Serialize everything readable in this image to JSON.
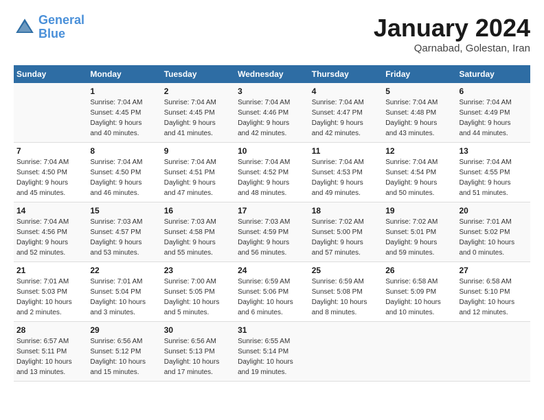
{
  "logo": {
    "line1": "General",
    "line2": "Blue"
  },
  "title": "January 2024",
  "subtitle": "Qarnabad, Golestan, Iran",
  "days_of_week": [
    "Sunday",
    "Monday",
    "Tuesday",
    "Wednesday",
    "Thursday",
    "Friday",
    "Saturday"
  ],
  "weeks": [
    [
      {
        "day": "",
        "info": ""
      },
      {
        "day": "1",
        "info": "Sunrise: 7:04 AM\nSunset: 4:45 PM\nDaylight: 9 hours\nand 40 minutes."
      },
      {
        "day": "2",
        "info": "Sunrise: 7:04 AM\nSunset: 4:45 PM\nDaylight: 9 hours\nand 41 minutes."
      },
      {
        "day": "3",
        "info": "Sunrise: 7:04 AM\nSunset: 4:46 PM\nDaylight: 9 hours\nand 42 minutes."
      },
      {
        "day": "4",
        "info": "Sunrise: 7:04 AM\nSunset: 4:47 PM\nDaylight: 9 hours\nand 42 minutes."
      },
      {
        "day": "5",
        "info": "Sunrise: 7:04 AM\nSunset: 4:48 PM\nDaylight: 9 hours\nand 43 minutes."
      },
      {
        "day": "6",
        "info": "Sunrise: 7:04 AM\nSunset: 4:49 PM\nDaylight: 9 hours\nand 44 minutes."
      }
    ],
    [
      {
        "day": "7",
        "info": "Sunrise: 7:04 AM\nSunset: 4:50 PM\nDaylight: 9 hours\nand 45 minutes."
      },
      {
        "day": "8",
        "info": "Sunrise: 7:04 AM\nSunset: 4:50 PM\nDaylight: 9 hours\nand 46 minutes."
      },
      {
        "day": "9",
        "info": "Sunrise: 7:04 AM\nSunset: 4:51 PM\nDaylight: 9 hours\nand 47 minutes."
      },
      {
        "day": "10",
        "info": "Sunrise: 7:04 AM\nSunset: 4:52 PM\nDaylight: 9 hours\nand 48 minutes."
      },
      {
        "day": "11",
        "info": "Sunrise: 7:04 AM\nSunset: 4:53 PM\nDaylight: 9 hours\nand 49 minutes."
      },
      {
        "day": "12",
        "info": "Sunrise: 7:04 AM\nSunset: 4:54 PM\nDaylight: 9 hours\nand 50 minutes."
      },
      {
        "day": "13",
        "info": "Sunrise: 7:04 AM\nSunset: 4:55 PM\nDaylight: 9 hours\nand 51 minutes."
      }
    ],
    [
      {
        "day": "14",
        "info": "Sunrise: 7:04 AM\nSunset: 4:56 PM\nDaylight: 9 hours\nand 52 minutes."
      },
      {
        "day": "15",
        "info": "Sunrise: 7:03 AM\nSunset: 4:57 PM\nDaylight: 9 hours\nand 53 minutes."
      },
      {
        "day": "16",
        "info": "Sunrise: 7:03 AM\nSunset: 4:58 PM\nDaylight: 9 hours\nand 55 minutes."
      },
      {
        "day": "17",
        "info": "Sunrise: 7:03 AM\nSunset: 4:59 PM\nDaylight: 9 hours\nand 56 minutes."
      },
      {
        "day": "18",
        "info": "Sunrise: 7:02 AM\nSunset: 5:00 PM\nDaylight: 9 hours\nand 57 minutes."
      },
      {
        "day": "19",
        "info": "Sunrise: 7:02 AM\nSunset: 5:01 PM\nDaylight: 9 hours\nand 59 minutes."
      },
      {
        "day": "20",
        "info": "Sunrise: 7:01 AM\nSunset: 5:02 PM\nDaylight: 10 hours\nand 0 minutes."
      }
    ],
    [
      {
        "day": "21",
        "info": "Sunrise: 7:01 AM\nSunset: 5:03 PM\nDaylight: 10 hours\nand 2 minutes."
      },
      {
        "day": "22",
        "info": "Sunrise: 7:01 AM\nSunset: 5:04 PM\nDaylight: 10 hours\nand 3 minutes."
      },
      {
        "day": "23",
        "info": "Sunrise: 7:00 AM\nSunset: 5:05 PM\nDaylight: 10 hours\nand 5 minutes."
      },
      {
        "day": "24",
        "info": "Sunrise: 6:59 AM\nSunset: 5:06 PM\nDaylight: 10 hours\nand 6 minutes."
      },
      {
        "day": "25",
        "info": "Sunrise: 6:59 AM\nSunset: 5:08 PM\nDaylight: 10 hours\nand 8 minutes."
      },
      {
        "day": "26",
        "info": "Sunrise: 6:58 AM\nSunset: 5:09 PM\nDaylight: 10 hours\nand 10 minutes."
      },
      {
        "day": "27",
        "info": "Sunrise: 6:58 AM\nSunset: 5:10 PM\nDaylight: 10 hours\nand 12 minutes."
      }
    ],
    [
      {
        "day": "28",
        "info": "Sunrise: 6:57 AM\nSunset: 5:11 PM\nDaylight: 10 hours\nand 13 minutes."
      },
      {
        "day": "29",
        "info": "Sunrise: 6:56 AM\nSunset: 5:12 PM\nDaylight: 10 hours\nand 15 minutes."
      },
      {
        "day": "30",
        "info": "Sunrise: 6:56 AM\nSunset: 5:13 PM\nDaylight: 10 hours\nand 17 minutes."
      },
      {
        "day": "31",
        "info": "Sunrise: 6:55 AM\nSunset: 5:14 PM\nDaylight: 10 hours\nand 19 minutes."
      },
      {
        "day": "",
        "info": ""
      },
      {
        "day": "",
        "info": ""
      },
      {
        "day": "",
        "info": ""
      }
    ]
  ]
}
